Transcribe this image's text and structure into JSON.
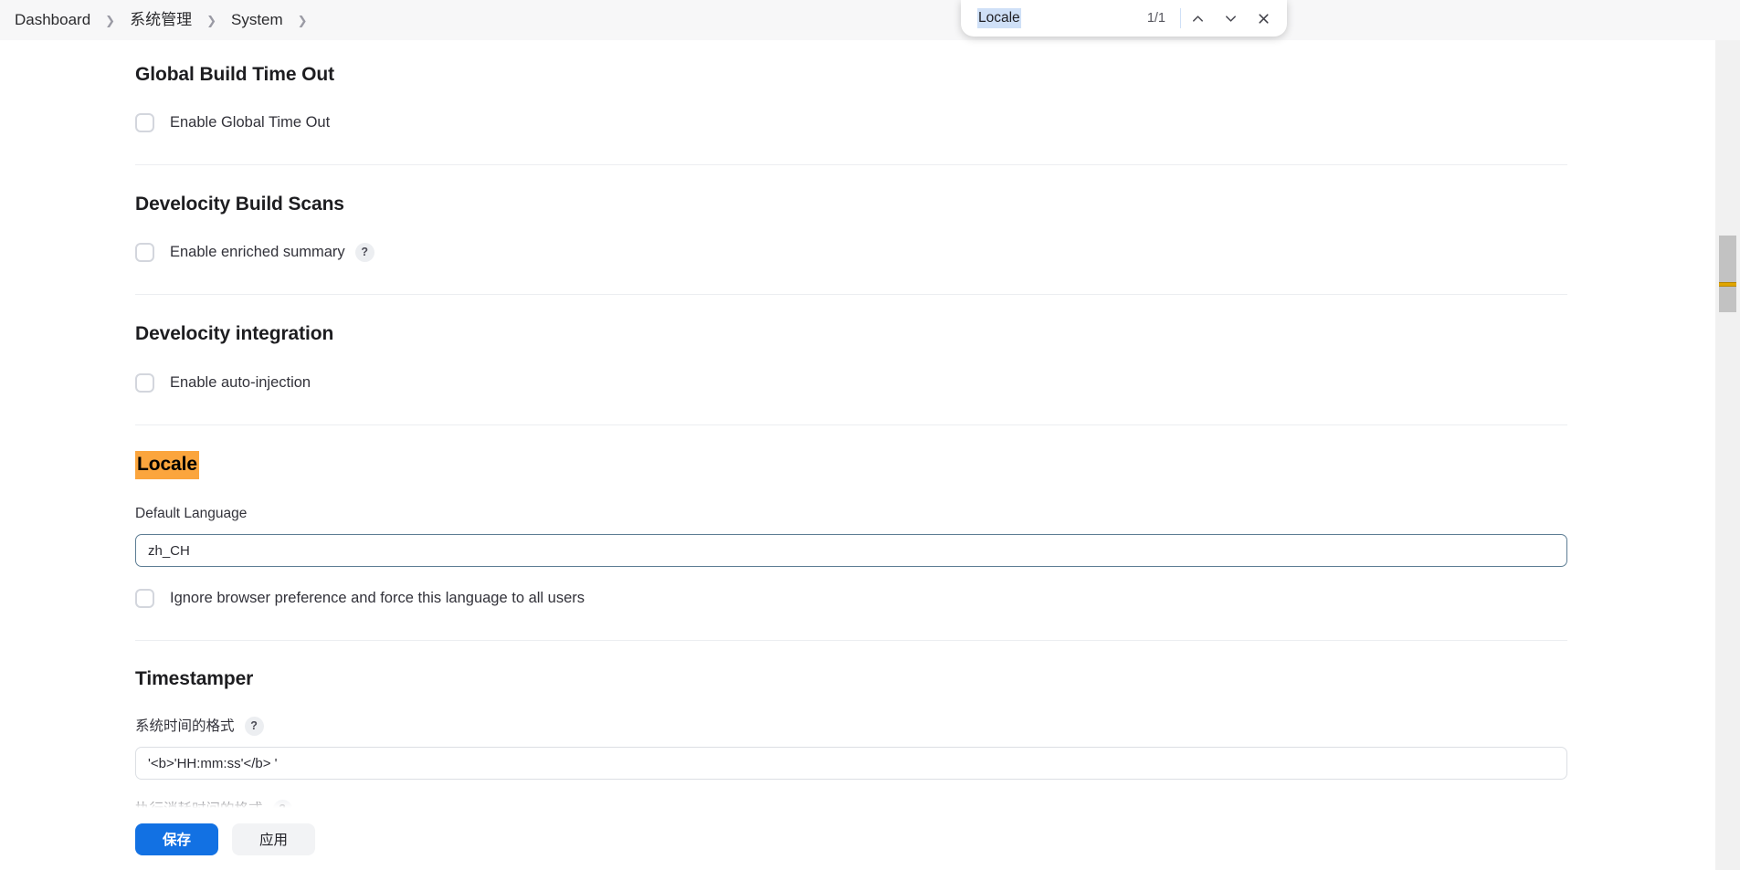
{
  "breadcrumb": {
    "items": [
      {
        "label": "Dashboard"
      },
      {
        "label": "系统管理"
      },
      {
        "label": "System"
      }
    ]
  },
  "find_bar": {
    "query": "Locale",
    "count": "1/1",
    "prev_icon": "chevron-up-icon",
    "next_icon": "chevron-down-icon",
    "close_icon": "close-icon"
  },
  "sections": [
    {
      "id": "global-build-time-out",
      "title": "Global Build Time Out",
      "checkbox_label": "Enable Global Time Out"
    },
    {
      "id": "develocity-build-scans",
      "title": "Develocity Build Scans",
      "checkbox_label": "Enable enriched summary",
      "help": "?"
    },
    {
      "id": "develocity-integration",
      "title": "Develocity integration",
      "checkbox_label": "Enable auto-injection"
    }
  ],
  "locale": {
    "title": "Locale",
    "highlighted": true,
    "highlight_color": "#fba53d",
    "default_language_label": "Default Language",
    "default_language_value": "zh_CH",
    "force_language_label": "Ignore browser preference and force this language to all users"
  },
  "timestamper": {
    "title": "Timestamper",
    "system_time_format_label": "系统时间的格式",
    "system_time_format_help": "?",
    "system_time_format_value": "'<b>'HH:mm:ss'</b> '",
    "elapsed_time_format_label": "执行消耗时间的格式",
    "elapsed_time_format_help": "?",
    "elapsed_time_format_value": ""
  },
  "save_bar": {
    "save_label": "保存",
    "apply_label": "应用",
    "save_color": "#1271e3"
  }
}
